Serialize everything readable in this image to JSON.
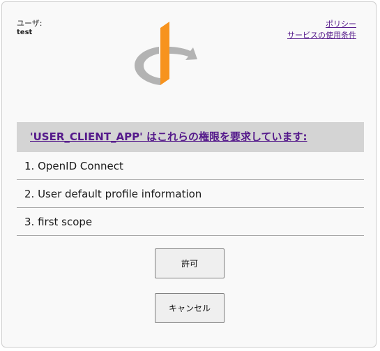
{
  "user": {
    "label": "ユーザ:",
    "name": "test"
  },
  "links": {
    "policy": "ポリシー",
    "terms": "サービスの使用条件"
  },
  "logo": {
    "icon": "openid-logo",
    "colors": {
      "orange": "#f7931e",
      "gray": "#b3b3b3"
    }
  },
  "request": {
    "header": "'USER_CLIENT_APP' はこれらの権限を要求しています:"
  },
  "scopes": [
    "1. OpenID Connect",
    "2. User default profile information",
    "3. first scope"
  ],
  "buttons": {
    "allow": "許可",
    "cancel": "キャンセル"
  }
}
